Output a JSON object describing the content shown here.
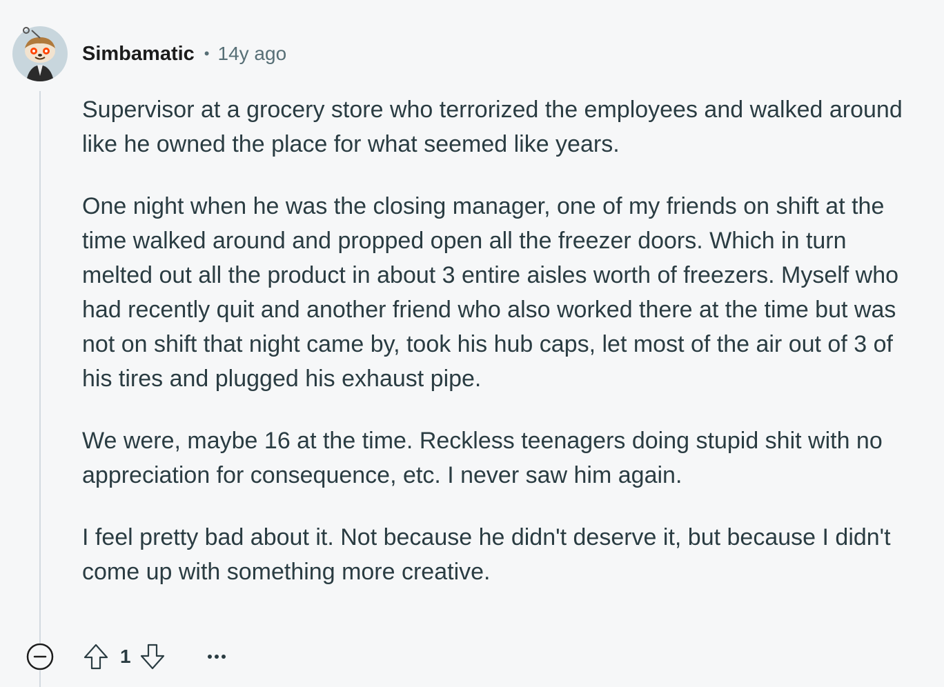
{
  "comment": {
    "username": "Simbamatic",
    "separator": "•",
    "time_ago": "14y ago",
    "paragraphs": [
      "Supervisor at a grocery store who terrorized the employees and walked around like he owned the place for what seemed like years.",
      "One night when he was the closing manager, one of my friends on shift at the time walked around and propped open all the freezer doors. Which in turn melted out all the product in about 3 entire aisles worth of freezers. Myself who had recently quit and another friend who also worked there at the time but was not on shift that night came by, took his hub caps, let most of the air out of 3 of his tires and plugged his exhaust pipe.",
      "We were, maybe 16 at the time. Reckless teenagers doing stupid shit with no appreciation for consequence, etc. I never saw him again.",
      "I feel pretty bad about it. Not because he didn't deserve it, but because I didn't come up with something more creative."
    ],
    "score": "1"
  },
  "icons": {
    "avatar": "snoo-avatar",
    "collapse": "collapse-minus-icon",
    "upvote": "upvote-arrow-icon",
    "downvote": "downvote-arrow-icon",
    "more": "more-options-icon"
  },
  "colors": {
    "background": "#f6f7f8",
    "text": "#2a3c42",
    "meta": "#576f76",
    "thread_line": "#d3dae0"
  }
}
